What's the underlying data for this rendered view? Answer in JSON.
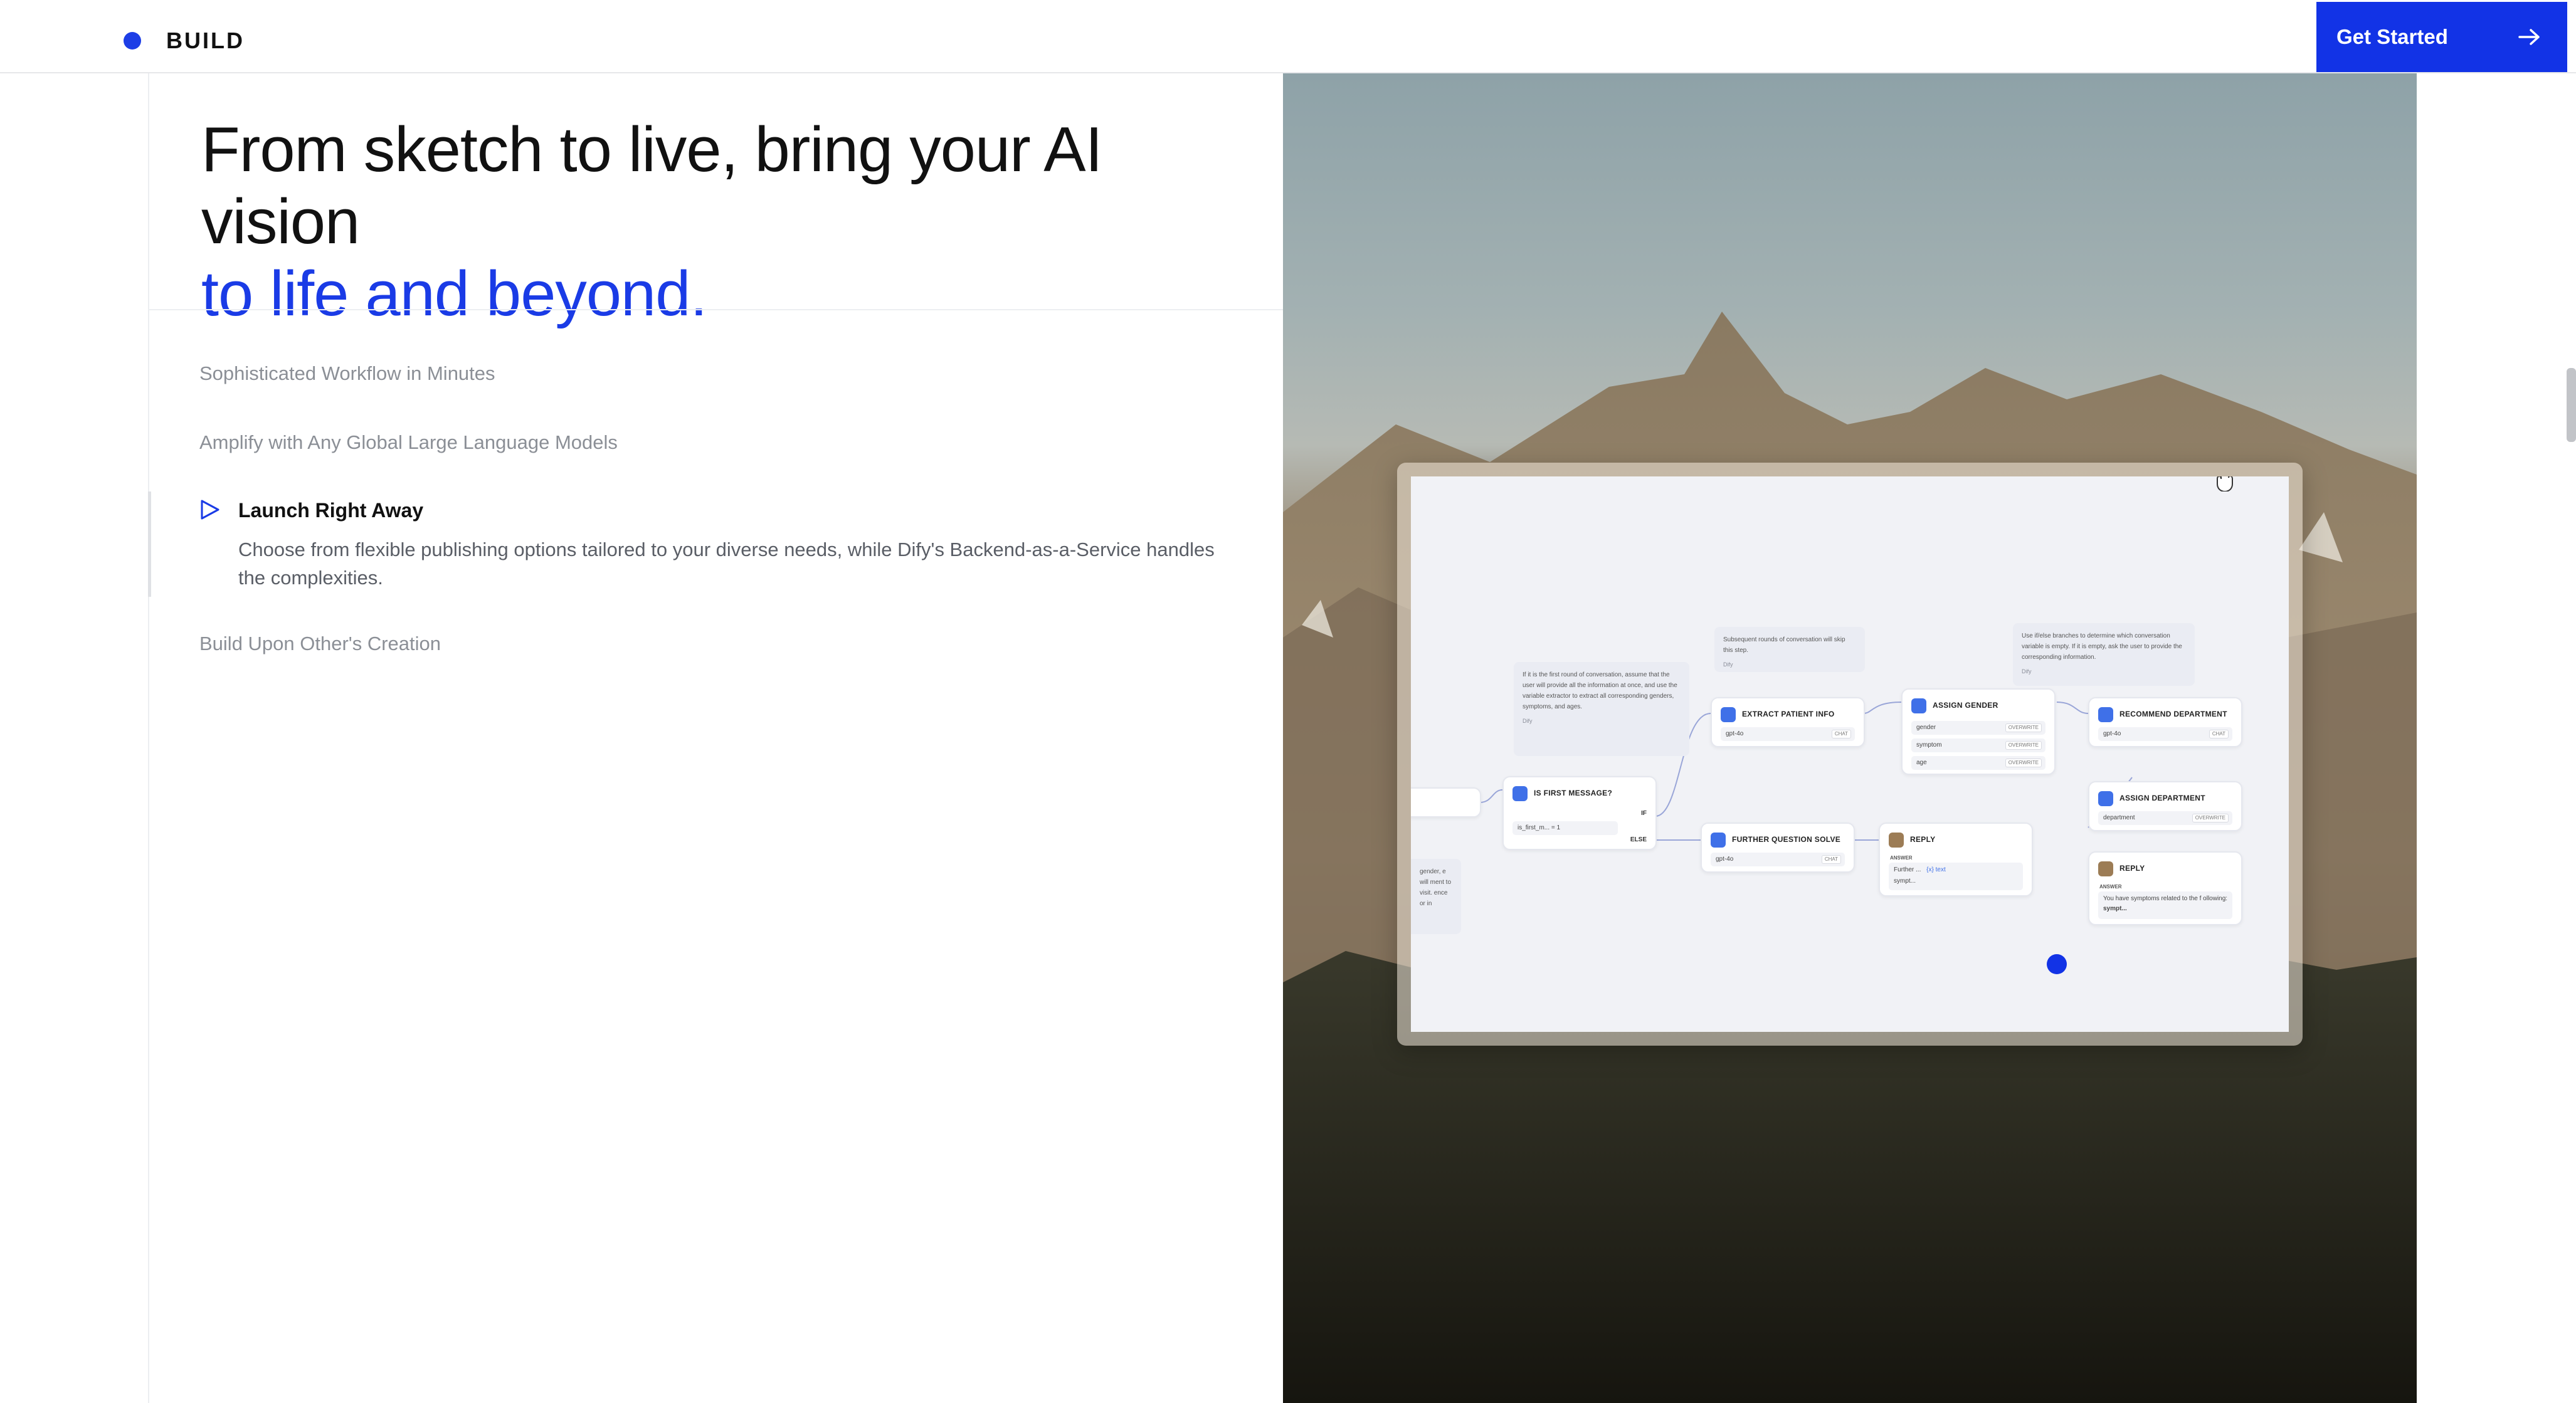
{
  "header": {
    "brand": "BUILD",
    "cta_label": "Get Started",
    "accent": "#1233e6"
  },
  "hero": {
    "headline_line1": "From sketch to live, bring your AI vision",
    "headline_line2": "to life and beyond."
  },
  "features": [
    {
      "label": "Sophisticated Workflow in Minutes",
      "active": false
    },
    {
      "label": "Amplify with Any Global Large Language Models",
      "active": false
    },
    {
      "label": "Launch Right Away",
      "active": true,
      "description": "Choose from flexible publishing options tailored to your diverse needs, while Dify's Backend-as-a-Service handles the complexities."
    },
    {
      "label": "Build Upon Other's Creation",
      "active": false
    }
  ],
  "workflow": {
    "notes": {
      "first_round": "If it is the first round of conversation, assume that the user will provide all the information at once, and use the variable extractor to extract all corresponding genders, symptoms, and ages.",
      "subsequent": "Subsequent rounds of conversation will skip this step.",
      "ifelse": "Use if/else branches to determine which conversation variable is empty. If it is empty, ask the user to provide the corresponding information.",
      "signature": "Dify",
      "left_fragment": "gender, e will ment to visit. ence or in"
    },
    "nodes": {
      "is_first": {
        "title": "IS FIRST MESSAGE?",
        "row": "is_first_m... = 1",
        "if": "IF",
        "else": "ELSE"
      },
      "extract": {
        "title": "EXTRACT PATIENT INFO",
        "row": "gpt-4o",
        "tag": "CHAT"
      },
      "further": {
        "title": "FURTHER QUESTION SOLVE",
        "row": "gpt-4o",
        "tag": "CHAT"
      },
      "assign_gender": {
        "title": "ASSIGN GENDER",
        "rows": [
          "gender",
          "symptom",
          "age"
        ],
        "tag": "OVERWRITE"
      },
      "reply1": {
        "title": "REPLY",
        "answer": "ANSWER",
        "line1": "Further ...",
        "line1b": "{x} text",
        "line2": "sympt..."
      },
      "recommend": {
        "title": "RECOMMEND DEPARTMENT",
        "row": "gpt-4o",
        "tag": "CHAT"
      },
      "assign_dept": {
        "title": "ASSIGN DEPARTMENT",
        "row": "department",
        "tag": "OVERWRITE"
      },
      "reply2": {
        "title": "REPLY",
        "answer": "ANSWER",
        "text": "You have symptoms related to the f ollowing:",
        "var": "sympt..."
      }
    }
  }
}
